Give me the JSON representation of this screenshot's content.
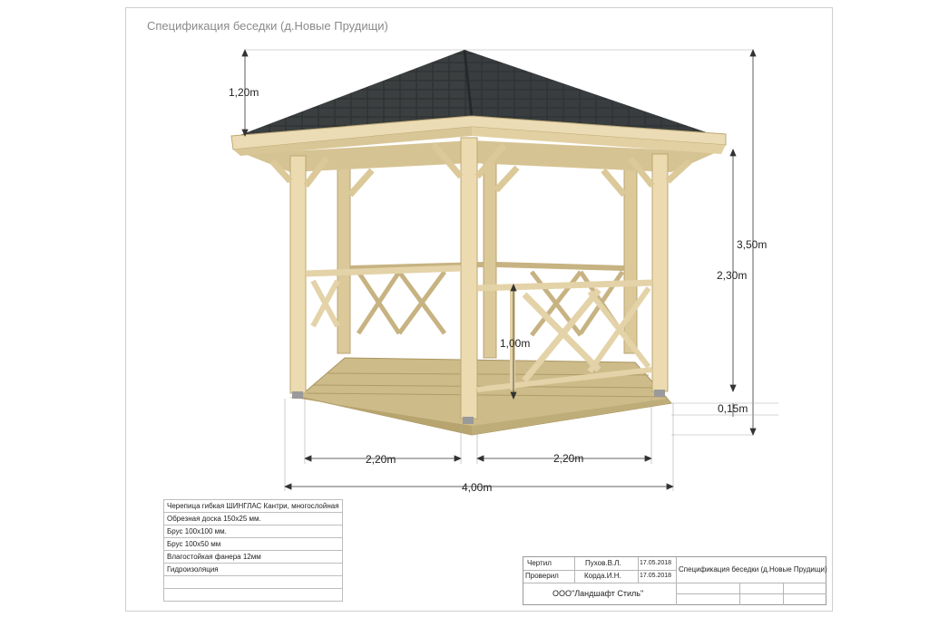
{
  "title": "Спецификация беседки (д.Новые Прудищи)",
  "dimensions": {
    "roof_height": "1,20m",
    "total_height": "3,50m",
    "post_height": "2,30m",
    "rail_height": "1,00m",
    "floor_height": "0,15m",
    "side_left": "2,20m",
    "side_right": "2,20m",
    "width": "4,00m"
  },
  "materials": [
    "Черепица гибкая ШИНГЛАС Кантри, многослойная",
    "Обрезная доска 150х25 мм.",
    "Брус 100х100 мм.",
    "Брус 100х50 мм",
    "Влагостойкая фанера 12мм",
    "Гидроизоляция",
    "",
    ""
  ],
  "stamp": {
    "drawn_label": "Чертил",
    "drawn_by": "Пухов.В.Л.",
    "drawn_date": "17.05.2018",
    "checked_label": "Проверил",
    "checked_by": "Корда.И.Н.",
    "checked_date": "17.05.2018",
    "doc_title": "Спецификация беседки (д.Новые Прудищи)",
    "company": "ООО\"Ландшафт Стиль\""
  },
  "colors": {
    "roof": "#3b3f40",
    "wood": "#e7d6ae",
    "wood_dark": "#c9b583",
    "floor": "#cdbb8a"
  }
}
